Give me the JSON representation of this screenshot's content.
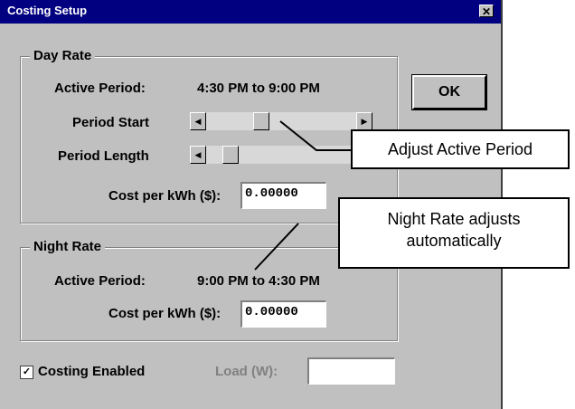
{
  "window": {
    "title": "Costing Setup",
    "close_glyph": "✕"
  },
  "day_rate": {
    "group_label": "Day Rate",
    "active_period_label": "Active Period:",
    "active_period_value": "4:30 PM to 9:00 PM",
    "period_start_label": "Period Start",
    "period_length_label": "Period Length",
    "cost_label": "Cost per kWh ($):",
    "cost_value": "0.00000"
  },
  "night_rate": {
    "group_label": "Night Rate",
    "active_period_label": "Active Period:",
    "active_period_value": "9:00 PM to 4:30 PM",
    "cost_label": "Cost per kWh ($):",
    "cost_value": "0.00000"
  },
  "ok_label": "OK",
  "costing_enabled_label": "Costing Enabled",
  "costing_enabled_checked": true,
  "load_label": "Load (W):",
  "load_value": "",
  "callouts": {
    "adjust": "Adjust Active Period",
    "night_line1": "Night Rate adjusts",
    "night_line2": "automatically"
  }
}
